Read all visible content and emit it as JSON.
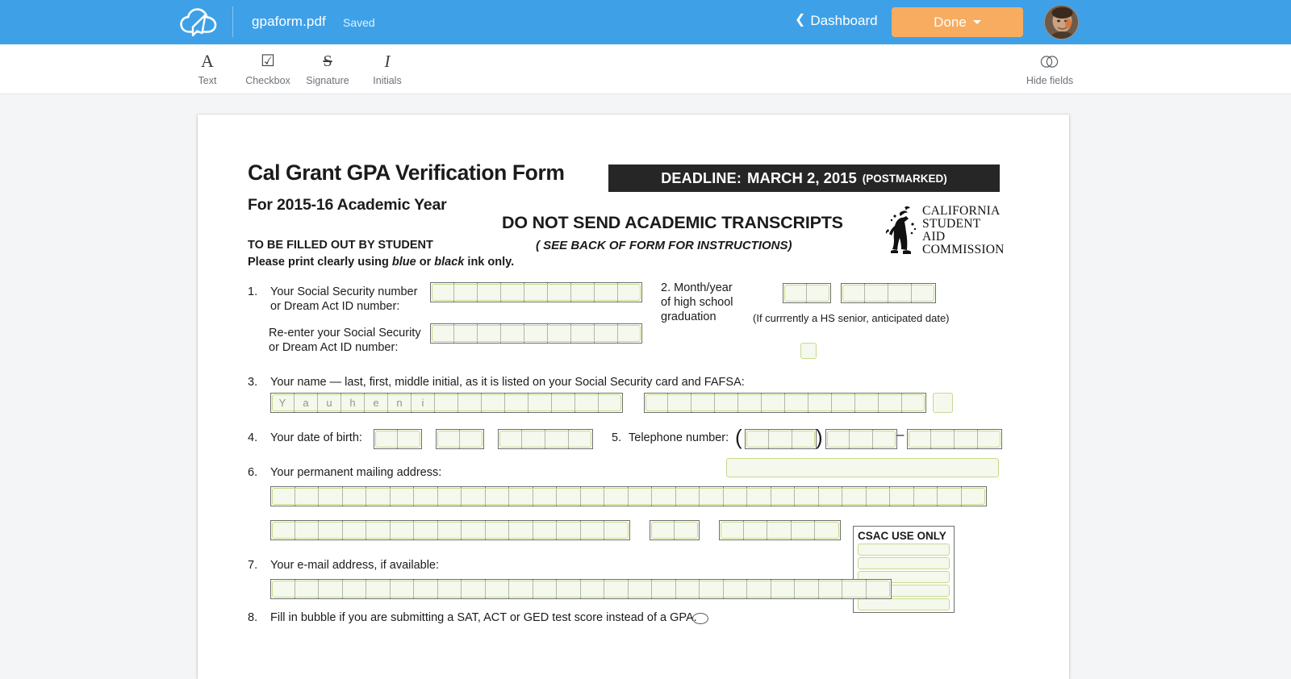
{
  "app": {
    "logo_icon": "cloud-arrow-logo",
    "doc_title": "gpaform.pdf",
    "save_status": "Saved",
    "dashboard_label": "Dashboard",
    "done_label": "Done",
    "accent_blue": "#3ea1e8",
    "accent_orange": "#f7ac5f"
  },
  "toolbar": {
    "tools": [
      {
        "label": "Text",
        "glyph": "A",
        "icon": "text-tool-icon"
      },
      {
        "label": "Checkbox",
        "glyph": "☑",
        "icon": "checkbox-tool-icon"
      },
      {
        "label": "Signature",
        "glyph": "S",
        "icon": "signature-tool-icon"
      },
      {
        "label": "Initials",
        "glyph": "I",
        "icon": "initials-tool-icon"
      }
    ],
    "hide_fields_label": "Hide fields",
    "hide_fields_icon": "toggle-icon"
  },
  "document": {
    "title": "Cal Grant GPA Verification Form",
    "subtitle": "For 2015-16 Academic Year",
    "deadline": {
      "prefix": "DEADLINE:",
      "date": "MARCH 2, 2015",
      "suffix": "(POSTMARKED)"
    },
    "filled_by": "TO BE FILLED OUT BY STUDENT",
    "print_note_1": "Please print clearly using ",
    "print_note_blue": "blue",
    "print_note_or": " or ",
    "print_note_black": "black",
    "print_note_2": " ink only.",
    "no_transcripts": "DO NOT SEND ACADEMIC TRANSCRIPTS",
    "see_back": "( SEE BACK OF FORM FOR INSTRUCTIONS)",
    "agency_logo_lines": [
      "CALIFORNIA",
      "STUDENT AID",
      "COMMISSION"
    ],
    "items": {
      "q1": {
        "number": "1.",
        "label_line1": "Your Social Security number",
        "label_line2": "or Dream Act ID number:",
        "reenter_line1": "Re-enter your Social Security",
        "reenter_line2": "or Dream Act ID number:",
        "boxes": 9,
        "value": ""
      },
      "q2": {
        "number": "2.",
        "label_line1": "Month/year",
        "label_line2": "of high school",
        "label_line3": "graduation",
        "hint": "(If currrently a HS senior, anticipated date)",
        "month_boxes": 2,
        "year_boxes": 4
      },
      "q3": {
        "number": "3.",
        "label": "Your name — last, first, middle initial, as it is listed on your Social Security card and FAFSA:",
        "left_boxes": 15,
        "left_value": "Yauheni",
        "right_boxes": 12
      },
      "q4": {
        "number": "4.",
        "label": "Your date of birth:",
        "month_boxes": 2,
        "day_boxes": 2,
        "year_boxes": 4
      },
      "q5": {
        "number": "5.",
        "label": "Telephone number:",
        "area_boxes": 3,
        "prefix_boxes": 3,
        "line_boxes": 4
      },
      "q6": {
        "number": "6.",
        "label": "Your permanent mailing address:",
        "row1_boxes": 30,
        "row2_city_boxes": 15,
        "row2_state_boxes": 2,
        "row2_zip_boxes": 5
      },
      "q7": {
        "number": "7.",
        "label": "Your e-mail address, if available:",
        "boxes": 26
      },
      "q8": {
        "number": "8.",
        "label": "Fill in bubble if you are submitting a SAT, ACT or GED test score instead of a GPA.",
        "bubble_icon": "radio-bubble-icon"
      }
    },
    "csac_use_only": {
      "header": "CSAC USE ONLY",
      "lines": 5
    }
  }
}
